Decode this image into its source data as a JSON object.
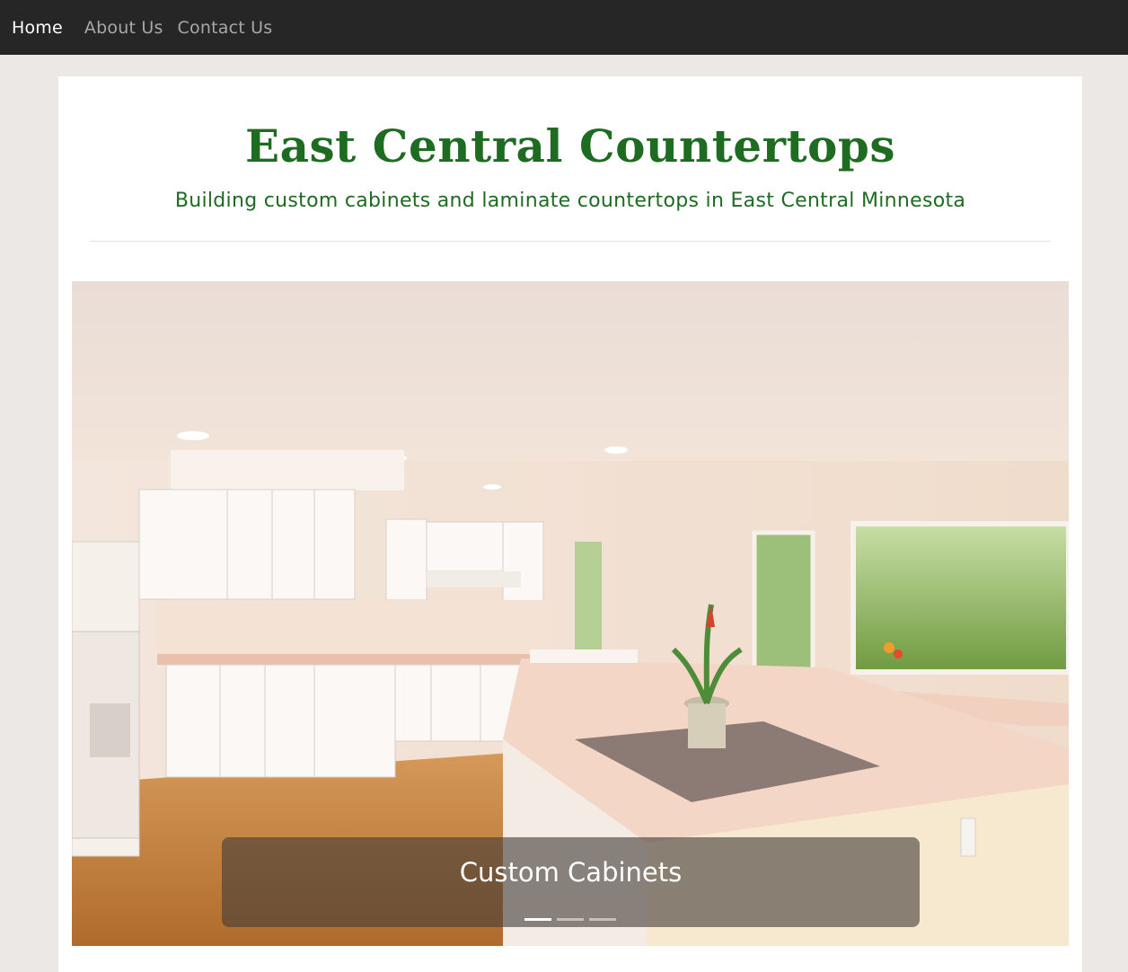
{
  "nav": {
    "items": [
      {
        "label": "Home",
        "active": true
      },
      {
        "label": "About Us",
        "active": false
      },
      {
        "label": "Contact Us",
        "active": false
      }
    ]
  },
  "header": {
    "title": "East Central Countertops",
    "tagline": "Building custom cabinets and laminate countertops in East Central Minnesota"
  },
  "carousel": {
    "caption": "Custom Cabinets",
    "slide_count": 3,
    "active_slide": 1
  },
  "colors": {
    "brand_green": "#1e6b22",
    "navbar_bg": "#262626",
    "page_bg": "#ece8e6"
  }
}
